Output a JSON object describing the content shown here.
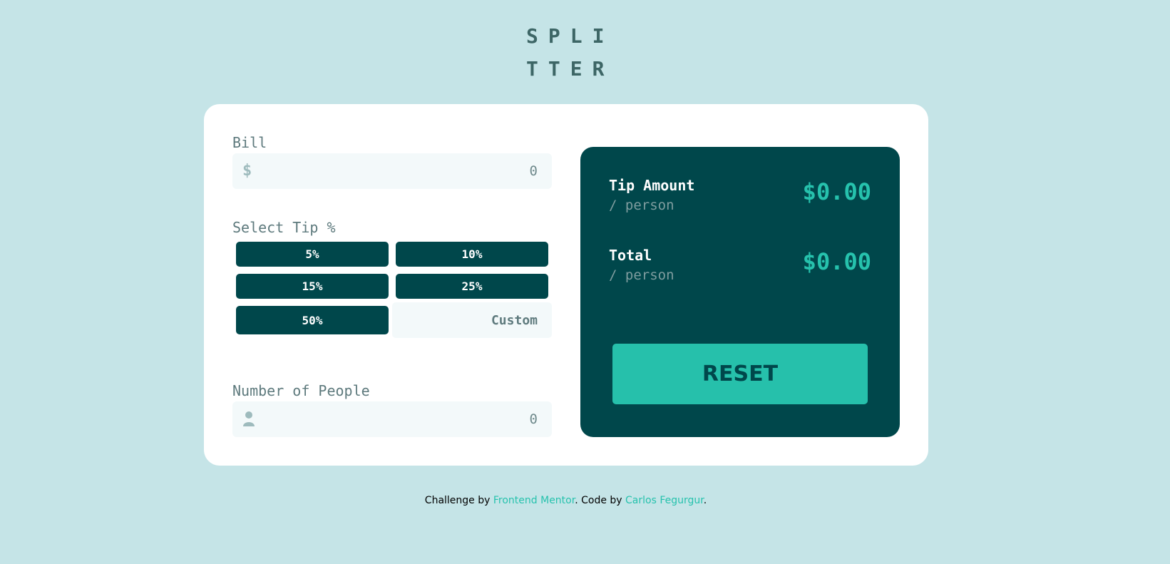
{
  "logo": {
    "line1": "SPLI",
    "line2": "TTER"
  },
  "bill": {
    "label": "Bill",
    "placeholder": "0",
    "icon": "dollar-icon",
    "icon_glyph": "$"
  },
  "tip": {
    "label": "Select Tip %",
    "options": [
      "5%",
      "10%",
      "15%",
      "25%",
      "50%"
    ],
    "custom_placeholder": "Custom"
  },
  "people": {
    "label": "Number of People",
    "placeholder": "0",
    "icon": "person-icon"
  },
  "results": {
    "tip_title": "Tip Amount",
    "tip_sub": "/ person",
    "tip_value": "$0.00",
    "total_title": "Total",
    "total_sub": "/ person",
    "total_value": "$0.00",
    "reset_label": "RESET"
  },
  "footer": {
    "prefix": "Challenge by ",
    "link1": "Frontend Mentor",
    "middle": ". Code by ",
    "link2": "Carlos Fegurgur",
    "suffix": "."
  },
  "colors": {
    "background": "#c5e4e7",
    "dark_cyan": "#00474b",
    "strong_cyan": "#26c2ad",
    "input_bg": "#f3f9fa"
  }
}
